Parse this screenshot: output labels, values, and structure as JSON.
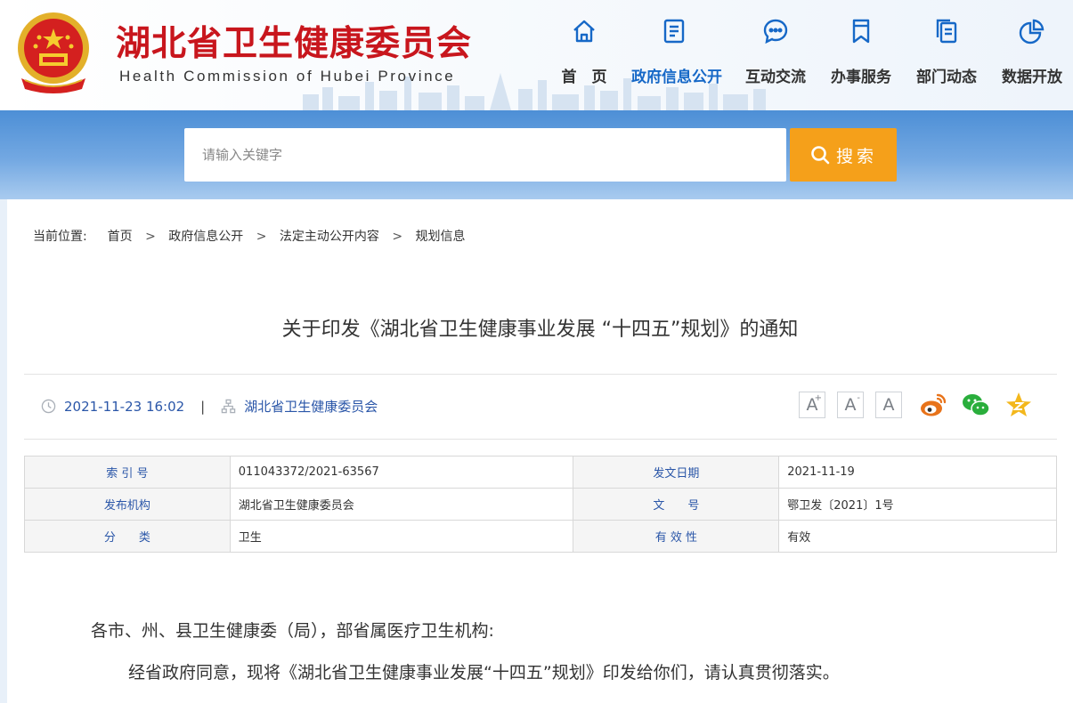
{
  "site": {
    "title": "湖北省卫生健康委员会",
    "subtitle": "Health Commission of Hubei Province"
  },
  "nav": {
    "items": [
      {
        "label": "首　页",
        "icon": "home-icon",
        "active": false
      },
      {
        "label": "政府信息公开",
        "icon": "document-icon",
        "active": true
      },
      {
        "label": "互动交流",
        "icon": "chat-icon",
        "active": false
      },
      {
        "label": "办事服务",
        "icon": "bookmark-icon",
        "active": false
      },
      {
        "label": "部门动态",
        "icon": "copy-icon",
        "active": false
      },
      {
        "label": "数据开放",
        "icon": "pie-chart-icon",
        "active": false
      }
    ]
  },
  "search": {
    "placeholder": "请输入关键字",
    "button_label": "搜索"
  },
  "breadcrumb": {
    "prefix": "当前位置:",
    "items": [
      "首页",
      "政府信息公开",
      "法定主动公开内容",
      "规划信息"
    ]
  },
  "article": {
    "title": "关于印发《湖北省卫生健康事业发展 “十四五”规划》的通知",
    "datetime": "2021-11-23 16:02",
    "publisher": "湖北省卫生健康委员会",
    "font_sizes": [
      "A",
      "A",
      "A"
    ],
    "font_size_marks": [
      "+",
      "-"
    ]
  },
  "meta_table": [
    {
      "k1": "索 引 号",
      "v1": "011043372/2021-63567",
      "k2": "发文日期",
      "v2": "2021-11-19"
    },
    {
      "k1": "发布机构",
      "v1": "湖北省卫生健康委员会",
      "k2": "文　　号",
      "v2": "鄂卫发〔2021〕1号"
    },
    {
      "k1": "分　　类",
      "v1": "卫生",
      "k2": "有 效 性",
      "v2": "有效"
    }
  ],
  "body": {
    "p1": "各市、州、县卫生健康委（局），部省属医疗卫生机构:",
    "p2": "经省政府同意，现将《湖北省卫生健康事业发展“十四五”规划》印发给你们，请认真贯彻落实。"
  },
  "colors": {
    "brand_red": "#c8161d",
    "nav_blue": "#1668c7",
    "search_orange": "#f5a01a",
    "weibo_orange": "#e8731a",
    "wechat_green": "#2aae3c",
    "star_yellow": "#f3b71c"
  }
}
